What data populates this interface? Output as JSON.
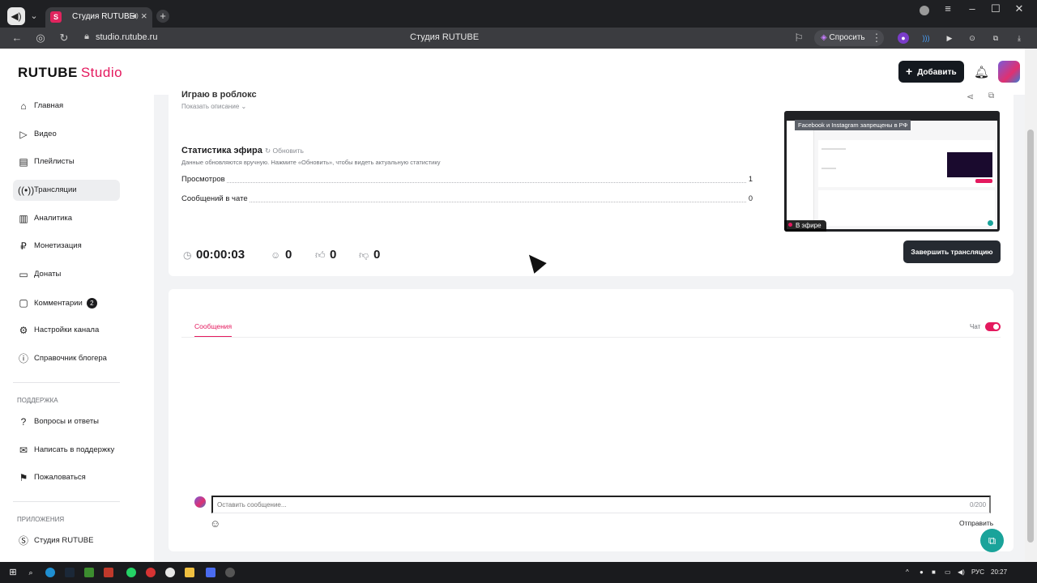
{
  "browser": {
    "tab_title": "Студия RUTUBE",
    "tab_favicon": "S",
    "url": "studio.rutube.ru",
    "page_title": "Студия RUTUBE",
    "ask_label": "Спросить"
  },
  "header": {
    "logo_main": "RUTUBE",
    "logo_studio": "Studio",
    "add_button": "Добавить"
  },
  "sidebar": {
    "items": [
      {
        "label": "Главная",
        "icon": "home-icon"
      },
      {
        "label": "Видео",
        "icon": "video-icon"
      },
      {
        "label": "Плейлисты",
        "icon": "playlist-icon"
      },
      {
        "label": "Трансляции",
        "icon": "broadcast-icon",
        "active": true
      },
      {
        "label": "Аналитика",
        "icon": "analytics-icon"
      },
      {
        "label": "Монетизация",
        "icon": "ruble-icon"
      },
      {
        "label": "Донаты",
        "icon": "donate-icon"
      },
      {
        "label": "Комментарии",
        "icon": "comments-icon",
        "badge": "2"
      },
      {
        "label": "Настройки канала",
        "icon": "gear-icon"
      },
      {
        "label": "Справочник блогера",
        "icon": "info-icon"
      }
    ],
    "support_heading": "ПОДДЕРЖКА",
    "support_items": [
      {
        "label": "Вопросы и ответы",
        "icon": "help-icon"
      },
      {
        "label": "Написать в поддержку",
        "icon": "mail-icon"
      },
      {
        "label": "Пожаловаться",
        "icon": "flag-icon"
      }
    ],
    "apps_heading": "ПРИЛОЖЕНИЯ",
    "app_items": [
      {
        "label": "Студия RUTUBE",
        "icon": "studio-app-icon"
      }
    ]
  },
  "stream": {
    "title": "Играю в роблокс",
    "show_description": "Показать описание",
    "stats_title": "Статистика эфира",
    "refresh_label": "Обновить",
    "stats_note": "Данные обновляются вручную. Нажмите «Обновить», чтобы видеть актуальную статистику",
    "stats": [
      {
        "label": "Просмотров",
        "value": "1"
      },
      {
        "label": "Сообщений в чате",
        "value": "0"
      }
    ],
    "duration": "00:00:03",
    "viewers": "0",
    "likes": "0",
    "dislikes": "0",
    "end_button": "Завершить трансляцию",
    "preview_banner": "Facebook и Instagram запрещены в РФ",
    "live_label": "В эфире"
  },
  "chat": {
    "tab_messages": "Сообщения",
    "chat_toggle_label": "Чат",
    "chat_enabled": true,
    "input_placeholder": "Оставить сообщение...",
    "char_count": "0/200",
    "send_label": "Отправить"
  },
  "taskbar": {
    "lang": "РУС",
    "time": "20:27"
  },
  "colors": {
    "accent": "#e4195e",
    "dark_button": "#252a31",
    "fab": "#1aa39a"
  }
}
